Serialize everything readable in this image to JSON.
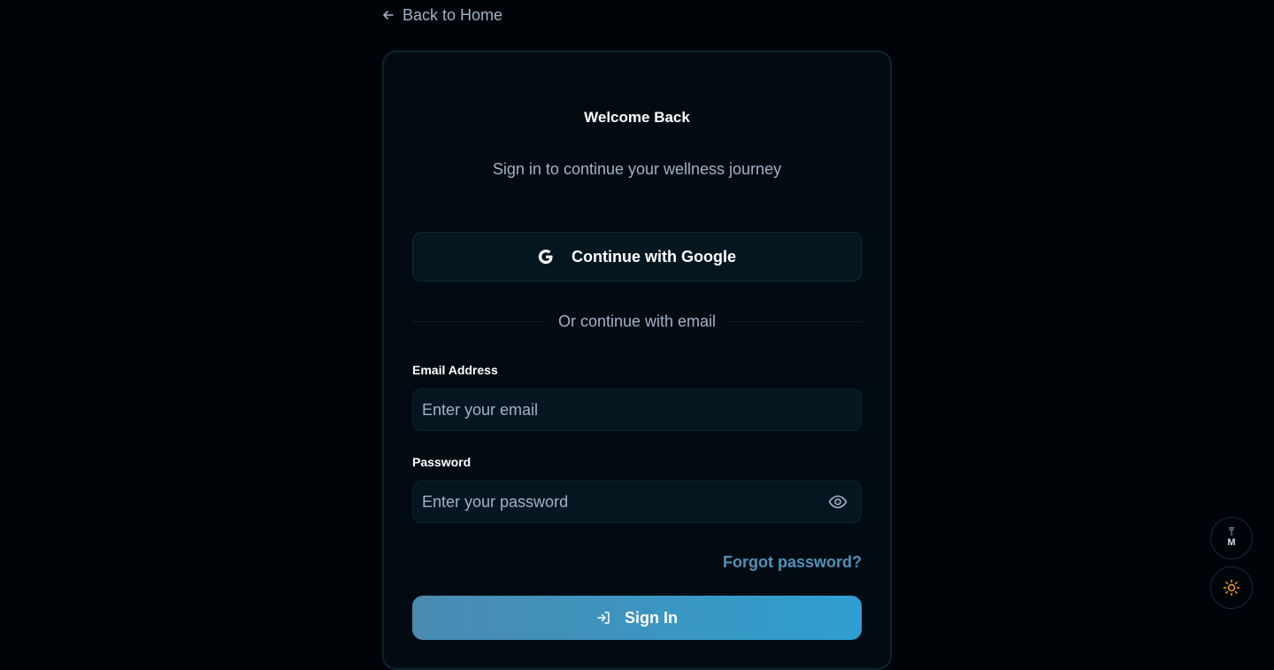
{
  "nav": {
    "back_label": "Back to Home"
  },
  "card": {
    "title": "Welcome Back",
    "subtitle": "Sign in to continue your wellness journey",
    "google_label": "Continue with Google",
    "divider_text": "Or continue with email",
    "email": {
      "label": "Email Address",
      "placeholder": "Enter your email",
      "value": ""
    },
    "password": {
      "label": "Password",
      "placeholder": "Enter your password",
      "value": ""
    },
    "forgot_label": "Forgot password?",
    "signin_label": "Sign In"
  },
  "floating": {
    "text_size_top": "T",
    "text_size_bottom": "M",
    "theme_icon": "sun-icon"
  },
  "colors": {
    "background": "#000408",
    "card": "#030b12",
    "accent": "#2f9fd0",
    "link": "#4f91b8",
    "sun": "#f0a020"
  }
}
